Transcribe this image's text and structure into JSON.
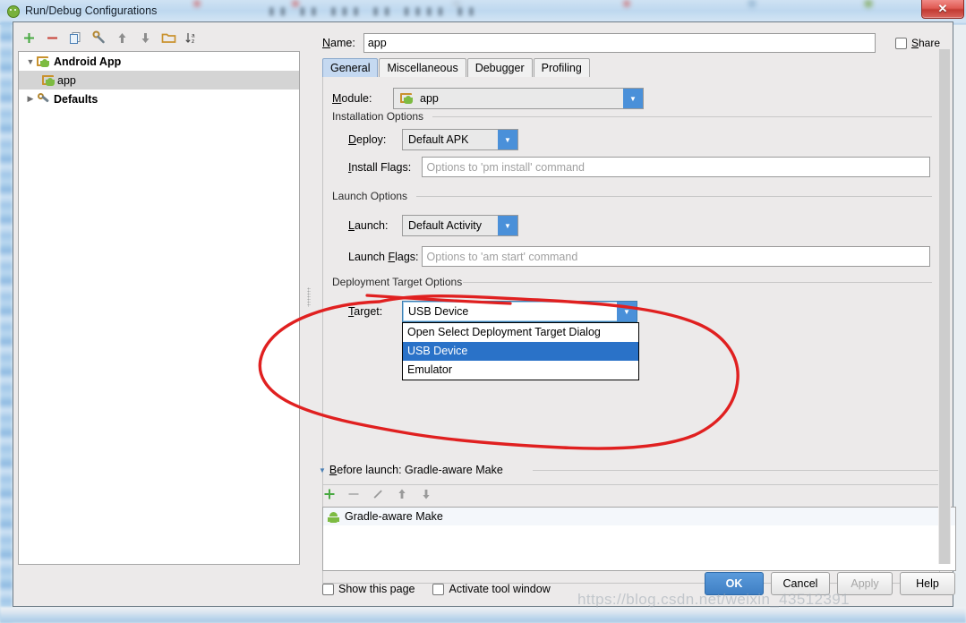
{
  "window": {
    "title": "Run/Debug Configurations",
    "close_label": "✕",
    "app_icon": "android-head-icon"
  },
  "left_panel": {
    "toolbar": [
      {
        "name": "add-icon",
        "glyph": "+"
      },
      {
        "name": "remove-icon",
        "glyph": "−"
      },
      {
        "name": "copy-icon",
        "glyph": "copy"
      },
      {
        "name": "edit-defaults-icon",
        "glyph": "wrench"
      },
      {
        "name": "move-up-icon",
        "glyph": "↑"
      },
      {
        "name": "move-down-icon",
        "glyph": "↓"
      },
      {
        "name": "folder-icon",
        "glyph": "folder"
      },
      {
        "name": "sort-alphabetically-icon",
        "glyph": "↓az"
      }
    ],
    "tree": [
      {
        "label": "Android App",
        "indent": 0,
        "expander": "▼",
        "icon": "android-folder-icon",
        "bold": true,
        "selected": false
      },
      {
        "label": "app",
        "indent": 1,
        "expander": "",
        "icon": "android-folder-icon",
        "bold": false,
        "selected": true
      },
      {
        "label": "Defaults",
        "indent": 0,
        "expander": "▶",
        "icon": "wrench-icon",
        "bold": true,
        "selected": false
      }
    ]
  },
  "form": {
    "name_label": "Name:",
    "name_value": "app",
    "share_label": "Share",
    "share_checked": false,
    "tabs": [
      {
        "label": "General",
        "active": true
      },
      {
        "label": "Miscellaneous",
        "active": false
      },
      {
        "label": "Debugger",
        "active": false
      },
      {
        "label": "Profiling",
        "active": false
      }
    ],
    "module_label": "Module:",
    "module_value": "app",
    "installation_options": {
      "group_title": "Installation Options",
      "deploy_label": "Deploy:",
      "deploy_value": "Default APK",
      "install_flags_label": "Install Flags:",
      "install_flags_value": "",
      "install_flags_placeholder": "Options to 'pm install' command"
    },
    "launch_options": {
      "group_title": "Launch Options",
      "launch_label": "Launch:",
      "launch_value": "Default Activity",
      "launch_flags_label": "Launch Flags:",
      "launch_flags_value": "",
      "launch_flags_placeholder": "Options to 'am start' command"
    },
    "deployment_target_options": {
      "group_title": "Deployment Target Options",
      "target_label": "Target:",
      "target_value": "USB Device",
      "dropdown_open": true,
      "dropdown_items": [
        {
          "label": "Open Select Deployment Target Dialog",
          "selected": false
        },
        {
          "label": "USB Device",
          "selected": true
        },
        {
          "label": "Emulator",
          "selected": false
        }
      ]
    },
    "before_launch": {
      "header": "Before launch: Gradle-aware Make",
      "toolbar": [
        {
          "name": "add-task-icon",
          "glyph": "+"
        },
        {
          "name": "remove-task-icon",
          "glyph": "−"
        },
        {
          "name": "edit-task-icon",
          "glyph": "pencil"
        },
        {
          "name": "move-task-up-icon",
          "glyph": "↑"
        },
        {
          "name": "move-task-down-icon",
          "glyph": "↓"
        }
      ],
      "items": [
        {
          "label": "Gradle-aware Make",
          "icon": "android-bugdroid-icon"
        }
      ]
    },
    "show_this_page_label": "Show this page",
    "show_this_page_checked": false,
    "activate_tool_window_label": "Activate tool window",
    "activate_tool_window_checked": false
  },
  "buttons": {
    "ok": "OK",
    "cancel": "Cancel",
    "apply": "Apply",
    "help": "Help"
  },
  "annotation": {
    "color": "#e02020",
    "shape": "hand-drawn-ellipse-around-deployment-target"
  },
  "watermark": "https://blog.csdn.net/weixin_43512391",
  "colors": {
    "accent_blue": "#4a90d9",
    "selection_blue": "#2a72c8",
    "tab_active": "#c5d9f1",
    "dialog_bg": "#eceaea",
    "annotation_red": "#e02020"
  }
}
